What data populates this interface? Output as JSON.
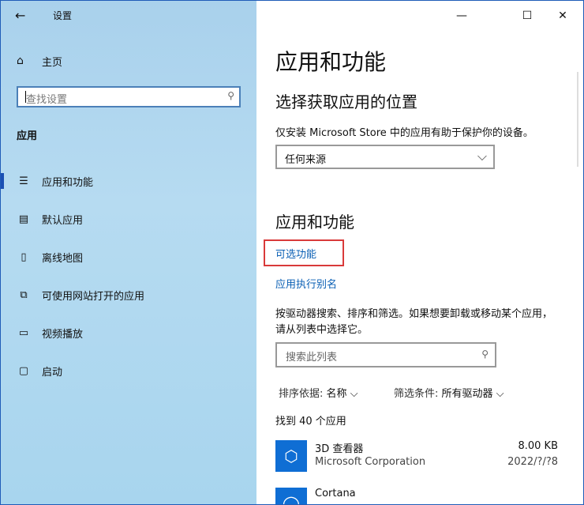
{
  "titlebar": {
    "back_icon": "back-arrow-icon",
    "title": "设置",
    "minimize": "—",
    "maximize": "☐",
    "close": "✕"
  },
  "sidebar": {
    "home_label": "主页",
    "search_placeholder": "查找设置",
    "section_title": "应用",
    "items": [
      {
        "label": "应用和功能",
        "icon": "apps-features-icon",
        "active": true
      },
      {
        "label": "默认应用",
        "icon": "default-apps-icon",
        "active": false
      },
      {
        "label": "离线地图",
        "icon": "offline-maps-icon",
        "active": false
      },
      {
        "label": "可使用网站打开的应用",
        "icon": "apps-for-websites-icon",
        "active": false
      },
      {
        "label": "视频播放",
        "icon": "video-playback-icon",
        "active": false
      },
      {
        "label": "启动",
        "icon": "startup-icon",
        "active": false
      }
    ]
  },
  "main": {
    "title": "应用和功能",
    "choose_location_heading": "选择获取应用的位置",
    "store_desc": "仅安装 Microsoft Store 中的应用有助于保护你的设备。",
    "source_dropdown_value": "任何来源",
    "apps_heading": "应用和功能",
    "optional_features_link": "可选功能",
    "app_execution_alias_link": "应用执行别名",
    "filter_desc": "按驱动器搜索、排序和筛选。如果想要卸载或移动某个应用，请从列表中选择它。",
    "list_search_placeholder": "搜索此列表",
    "sort_label": "排序依据:",
    "sort_value": "名称",
    "filter_label": "筛选条件:",
    "filter_value": "所有驱动器",
    "result_count": "找到 40 个应用",
    "apps": [
      {
        "name": "3D 查看器",
        "publisher": "Microsoft Corporation",
        "size": "8.00 KB",
        "date": "2022/?/?8"
      },
      {
        "name": "Cortana",
        "publisher": "",
        "size": "",
        "date": ""
      }
    ]
  },
  "colors": {
    "accent": "#1a4fb3",
    "link": "#0a5fb4",
    "highlight_box": "#d93a3a"
  }
}
